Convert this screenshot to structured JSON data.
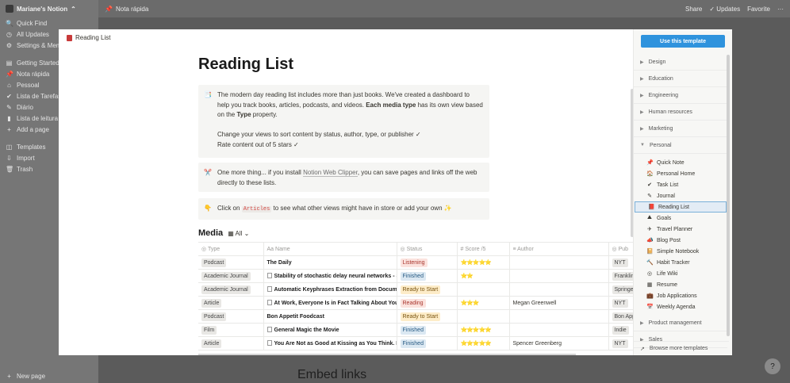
{
  "sidebar": {
    "workspace": "Mariane's Notion",
    "top": [
      {
        "icon": "search-icon",
        "glyph": "🔍",
        "label": "Quick Find"
      },
      {
        "icon": "clock-icon",
        "glyph": "◷",
        "label": "All Updates"
      },
      {
        "icon": "gear-icon",
        "glyph": "⚙",
        "label": "Settings & Members"
      }
    ],
    "pages": [
      {
        "icon": "page-icon",
        "glyph": "▤",
        "label": "Getting Started"
      },
      {
        "icon": "pushpin-icon",
        "glyph": "📌",
        "label": "Nota rápida"
      },
      {
        "icon": "house-icon",
        "glyph": "⌂",
        "label": "Pessoal"
      },
      {
        "icon": "checkmark-icon",
        "glyph": "✔",
        "label": "Lista de Tarefas"
      },
      {
        "icon": "pen-icon",
        "glyph": "✎",
        "label": "Diário"
      },
      {
        "icon": "book-icon",
        "glyph": "▮",
        "label": "Lista de leitura"
      },
      {
        "icon": "plus-icon",
        "glyph": "+",
        "label": "Add a page"
      }
    ],
    "bottom": [
      {
        "icon": "templates-icon",
        "glyph": "◫",
        "label": "Templates"
      },
      {
        "icon": "import-icon",
        "glyph": "⇩",
        "label": "Import"
      },
      {
        "icon": "trash-icon",
        "glyph": "🗑",
        "label": "Trash"
      }
    ],
    "new_page": "New page"
  },
  "topbar": {
    "breadcrumb": "Nota rápida",
    "share": "Share",
    "updates": "Updates",
    "favorite": "Favorite",
    "more": "···"
  },
  "background": {
    "embed_heading": "Embed links",
    "help": "?"
  },
  "modal": {
    "header": "Reading List",
    "title": "Reading List",
    "callout1": {
      "emoji": "📑",
      "line1": "The modern day reading list includes more than just books. We've created a dashboard to help you track books, articles, podcasts, and videos. ",
      "bold1": "Each media type",
      "line2": " has its own view based on the ",
      "bold2": "Type",
      "line3": " property.",
      "line4": "Change your views to sort content by status, author, type, or publisher ✓",
      "line5": "Rate content out of 5 stars ✓"
    },
    "callout2": {
      "emoji": "✂️",
      "pre": "One more thing... if you install ",
      "link": "Notion Web Clipper",
      "post": ", you can save pages and links off the web directly to these lists."
    },
    "callout3": {
      "emoji": "👇",
      "pre": "Click on ",
      "code": "Articles",
      "post": " to see what other views might have in store or add your own ✨"
    },
    "media_title": "Media",
    "view": "All",
    "columns": [
      "Type",
      "Name",
      "Status",
      "Score /5",
      "Author",
      "Pub"
    ],
    "rows": [
      {
        "type": "Podcast",
        "name": "The Daily",
        "page": false,
        "status": "Listening",
        "sc": "red",
        "score": "⭐⭐⭐⭐⭐",
        "author": "",
        "pub": "NYT"
      },
      {
        "type": "Academic Journal",
        "name": "Stability of stochastic delay neural networks - S",
        "page": true,
        "status": "Finished",
        "sc": "blue",
        "score": "⭐⭐",
        "author": "",
        "pub": "Franklin"
      },
      {
        "type": "Academic Journal",
        "name": "Automatic Keyphrases Extraction from Document",
        "page": true,
        "status": "Ready to Start",
        "sc": "yel",
        "score": "",
        "author": "",
        "pub": "Springer"
      },
      {
        "type": "Article",
        "name": "At Work, Everyone Is in Fact Talking About You",
        "page": true,
        "status": "Reading",
        "sc": "red",
        "score": "⭐⭐⭐",
        "author": "Megan Greenwell",
        "pub": "NYT"
      },
      {
        "type": "Podcast",
        "name": "Bon Appetit Foodcast",
        "page": false,
        "status": "Ready to Start",
        "sc": "yel",
        "score": "",
        "author": "",
        "pub": "Bon Appetit"
      },
      {
        "type": "Film",
        "name": "General Magic the Movie",
        "page": true,
        "status": "Finished",
        "sc": "blue",
        "score": "⭐⭐⭐⭐⭐",
        "author": "",
        "pub": "Indie"
      },
      {
        "type": "Article",
        "name": "You Are Not as Good at Kissing as You Think. But",
        "page": true,
        "status": "Finished",
        "sc": "blue",
        "score": "⭐⭐⭐⭐⭐",
        "author": "Spencer Greenberg",
        "pub": "NYT"
      }
    ]
  },
  "templates": {
    "use_button": "Use this template",
    "categories": [
      "Design",
      "Education",
      "Engineering",
      "Human resources",
      "Marketing",
      "Personal"
    ],
    "personal": [
      {
        "icon": "pushpin-icon",
        "glyph": "📌",
        "label": "Quick Note"
      },
      {
        "icon": "house-icon",
        "glyph": "🏠",
        "label": "Personal Home"
      },
      {
        "icon": "checkmark-icon",
        "glyph": "✔",
        "label": "Task List"
      },
      {
        "icon": "pen-icon",
        "glyph": "✎",
        "label": "Journal"
      },
      {
        "icon": "book-icon",
        "glyph": "📕",
        "label": "Reading List",
        "selected": true
      },
      {
        "icon": "mountain-icon",
        "glyph": "⛰",
        "label": "Goals"
      },
      {
        "icon": "airplane-icon",
        "glyph": "✈",
        "label": "Travel Planner"
      },
      {
        "icon": "megaphone-icon",
        "glyph": "📣",
        "label": "Blog Post"
      },
      {
        "icon": "notebook-icon",
        "glyph": "📔",
        "label": "Simple Notebook"
      },
      {
        "icon": "hammer-icon",
        "glyph": "🔨",
        "label": "Habit Tracker"
      },
      {
        "icon": "lifebuoy-icon",
        "glyph": "◎",
        "label": "Life Wiki"
      },
      {
        "icon": "resume-icon",
        "glyph": "▦",
        "label": "Resume"
      },
      {
        "icon": "briefcase-icon",
        "glyph": "💼",
        "label": "Job Applications"
      },
      {
        "icon": "calendar-icon",
        "glyph": "📅",
        "label": "Weekly Agenda"
      }
    ],
    "after": [
      "Product management",
      "Sales"
    ],
    "browse": "Browse more templates"
  }
}
